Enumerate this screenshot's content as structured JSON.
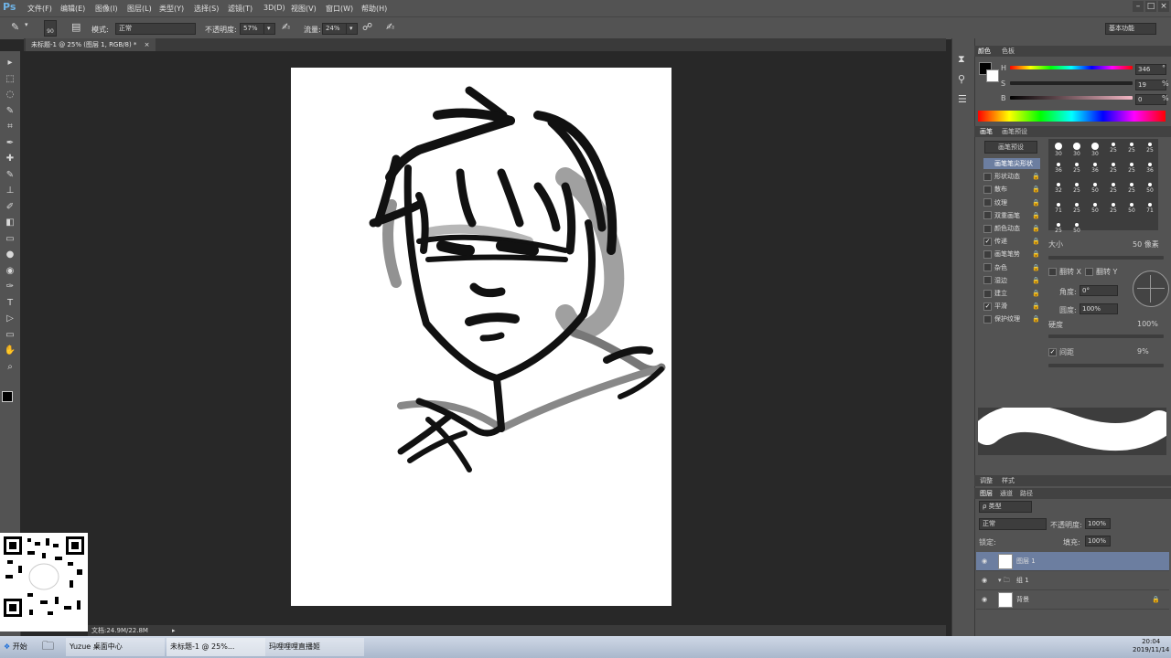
{
  "app": {
    "logo": "Ps"
  },
  "menu": [
    "文件(F)",
    "编辑(E)",
    "图像(I)",
    "图层(L)",
    "类型(Y)",
    "选择(S)",
    "滤镜(T)",
    "3D(D)",
    "视图(V)",
    "窗口(W)",
    "帮助(H)"
  ],
  "window_controls": [
    "–",
    "□",
    "×"
  ],
  "options_bar": {
    "brush_size": "90",
    "mode_label": "模式:",
    "mode_value": "正常",
    "opacity_label": "不透明度:",
    "opacity_value": "57%",
    "flow_label": "流量:",
    "flow_value": "24%",
    "workspace": "基本功能"
  },
  "document_tab": {
    "title": "未标题-1 @ 25% (图层 1, RGB/8) *",
    "close": "×"
  },
  "tools": [
    "move-icon",
    "marquee-icon",
    "lasso-icon",
    "quick-select-icon",
    "crop-icon",
    "eyedropper-icon",
    "healing-icon",
    "brush-icon",
    "clone-stamp-icon",
    "history-brush-icon",
    "eraser-icon",
    "gradient-icon",
    "blur-icon",
    "dodge-icon",
    "pen-icon",
    "type-icon",
    "path-select-icon",
    "shape-icon",
    "hand-icon",
    "zoom-icon"
  ],
  "tool_glyphs": [
    "▸",
    "⬚",
    "◌",
    "✎",
    "⌗",
    "✒",
    "✚",
    "✎",
    "⊥",
    "✐",
    "◧",
    "▭",
    "●",
    "◉",
    "✑",
    "T",
    "▷",
    "▭",
    "✋",
    "⌕"
  ],
  "status_text": "文档:24.9M/22.8M",
  "color_panel": {
    "tabs": [
      "颜色",
      "色板"
    ],
    "h_label": "H",
    "h_value": "346",
    "s_label": "S",
    "s_value": "19",
    "b_label": "B",
    "b_value": "0",
    "unit_deg": "°",
    "unit_pct": "%",
    "colors": {
      "foreground": "#000000",
      "background": "#ffffff"
    }
  },
  "brush_panel": {
    "tabs": [
      "画笔",
      "画笔预设"
    ],
    "preset_button": "画笔预设",
    "items": [
      {
        "label": "画笔笔尖形状",
        "checked": false,
        "active": true
      },
      {
        "label": "形状动态",
        "checked": false
      },
      {
        "label": "散布",
        "checked": false
      },
      {
        "label": "纹理",
        "checked": false
      },
      {
        "label": "双重画笔",
        "checked": false
      },
      {
        "label": "颜色动态",
        "checked": false
      },
      {
        "label": "传递",
        "checked": true
      },
      {
        "label": "画笔笔势",
        "checked": false
      },
      {
        "label": "杂色",
        "checked": false
      },
      {
        "label": "湿边",
        "checked": false
      },
      {
        "label": "建立",
        "checked": false
      },
      {
        "label": "平滑",
        "checked": true
      },
      {
        "label": "保护纹理",
        "checked": false
      }
    ],
    "brush_sizes": [
      "30",
      "30",
      "30",
      "25",
      "25",
      "25",
      "36",
      "25",
      "36",
      "25",
      "25",
      "36",
      "32",
      "25",
      "50",
      "25",
      "25",
      "50",
      "71",
      "25",
      "50",
      "25",
      "50",
      "71",
      "25",
      "50"
    ],
    "size_label": "大小",
    "size_value": "50 像素",
    "flip_x": "翻转 X",
    "flip_y": "翻转 Y",
    "angle_label": "角度:",
    "angle_value": "0°",
    "roundness_label": "圆度:",
    "roundness_value": "100%",
    "hardness_label": "硬度",
    "hardness_value": "100%",
    "spacing_label": "间距",
    "spacing_value": "9%"
  },
  "layers_panel": {
    "top_tabs": [
      "调整",
      "样式"
    ],
    "tabs": [
      "图层",
      "通道",
      "路径"
    ],
    "filter": "ρ 类型",
    "blend_mode": "正常",
    "opacity_label": "不透明度:",
    "opacity_value": "100%",
    "lock_label": "锁定:",
    "fill_label": "填充:",
    "fill_value": "100%",
    "layers": [
      {
        "name": "图层 1",
        "selected": true
      },
      {
        "name": "组 1",
        "selected": false
      },
      {
        "name": "背景",
        "selected": false
      }
    ]
  },
  "taskbar": {
    "start": "开始",
    "items": [
      "Yuzue 桌面中心",
      "未标题-1 @ 25%...",
      "玛哩哩哩直播姬"
    ],
    "time": "20:04",
    "date": "2019/11/14"
  }
}
